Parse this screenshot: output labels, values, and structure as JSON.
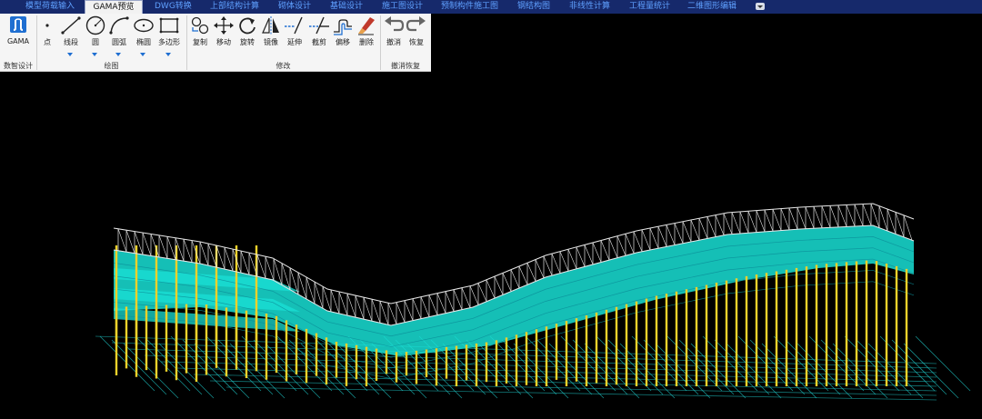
{
  "tabs": [
    {
      "label": "模型荷载输入"
    },
    {
      "label": "GAMA预览"
    },
    {
      "label": "DWG转换"
    },
    {
      "label": "上部结构计算"
    },
    {
      "label": "砌体设计"
    },
    {
      "label": "基础设计"
    },
    {
      "label": "施工图设计"
    },
    {
      "label": "预制构件施工图"
    },
    {
      "label": "钢结构图"
    },
    {
      "label": "非线性计算"
    },
    {
      "label": "工程量统计"
    },
    {
      "label": "二维图形编辑"
    }
  ],
  "active_tab": "GAMA预览",
  "ribbon": {
    "groups": [
      {
        "label": "数智设计"
      },
      {
        "label": "绘图"
      },
      {
        "label": "修改"
      },
      {
        "label": "撤消恢复"
      }
    ],
    "tools": [
      {
        "label": "GAMA",
        "icon": "gama-logo-icon"
      },
      {
        "label": "点",
        "icon": "point-icon"
      },
      {
        "label": "线段",
        "icon": "line-segment-icon"
      },
      {
        "label": "圆",
        "icon": "circle-icon"
      },
      {
        "label": "圆弧",
        "icon": "arc-icon"
      },
      {
        "label": "椭圆",
        "icon": "ellipse-icon"
      },
      {
        "label": "多边形",
        "icon": "polygon-icon"
      },
      {
        "label": "复制",
        "icon": "copy-icon"
      },
      {
        "label": "移动",
        "icon": "move-icon"
      },
      {
        "label": "旋转",
        "icon": "rotate-icon"
      },
      {
        "label": "镜像",
        "icon": "mirror-icon"
      },
      {
        "label": "延伸",
        "icon": "extend-icon"
      },
      {
        "label": "截剪",
        "icon": "trim-icon"
      },
      {
        "label": "偏移",
        "icon": "offset-icon"
      },
      {
        "label": "删除",
        "icon": "eraser-icon"
      },
      {
        "label": "撤消",
        "icon": "undo-icon"
      },
      {
        "label": "恢复",
        "icon": "redo-icon"
      }
    ]
  },
  "colors": {
    "tabbar_bg": "#16296b",
    "tab_text": "#5fa0ff",
    "ribbon_bg": "#f5f5f5",
    "viewport_bg": "#000000",
    "slab": "#19e0d6",
    "column": "#f0d22a",
    "truss": "#e8e8e8",
    "grid": "#1fc8c8",
    "accent_blue": "#1f6fd1"
  },
  "viewport": {
    "content": "3d-structural-model"
  }
}
